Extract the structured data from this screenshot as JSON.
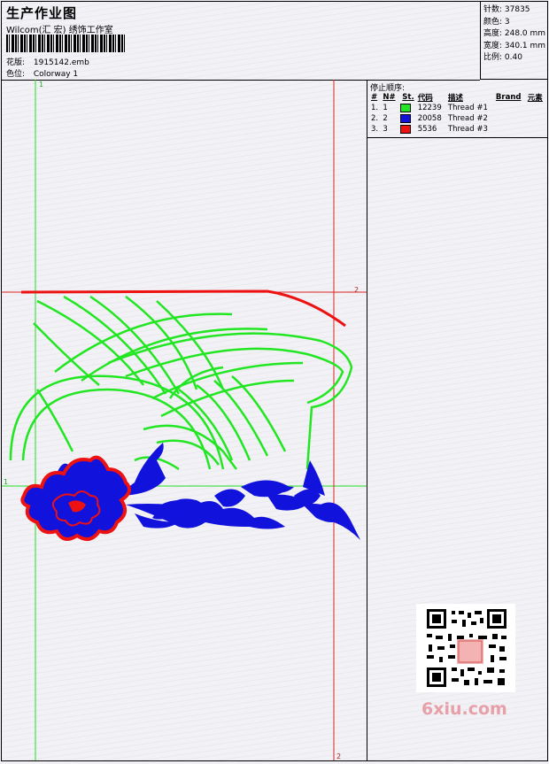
{
  "header": {
    "title": "生产作业图",
    "studio": "Wilcom(汇 宏) 绣饰工作室",
    "design_label": "花版:",
    "design_value": "1915142.emb",
    "colorway_label": "色位:",
    "colorway_value": "Colorway 1"
  },
  "stats": {
    "stitches": "针数: 37835",
    "colors": "颜色: 3",
    "height": "高度: 248.0 mm",
    "width": "宽度: 340.1 mm",
    "scale": "比例: 0.40"
  },
  "stop_sequence": {
    "title": "停止顺序:",
    "headers": [
      "#",
      "N#",
      "St.",
      "代码",
      "描述",
      "Brand",
      "元素"
    ],
    "rows": [
      {
        "idx": "1.",
        "n": "1",
        "color": "#22e622",
        "code": "12239",
        "desc": "Thread #1"
      },
      {
        "idx": "2.",
        "n": "2",
        "color": "#1212dd",
        "code": "20058",
        "desc": "Thread #2"
      },
      {
        "idx": "3.",
        "n": "3",
        "color": "#ee1111",
        "code": "5536",
        "desc": "Thread #3"
      }
    ]
  },
  "guides": {
    "left_marker": "1",
    "top_marker": "1",
    "right_marker": "2",
    "bottom_marker": "2"
  },
  "watermark": "6xiu.com",
  "colors": {
    "green_guide": "#22dd22",
    "red_guide": "#dd2222",
    "stitch_green": "#22e622",
    "stitch_blue": "#1212dd",
    "stitch_red": "#ee1111"
  }
}
